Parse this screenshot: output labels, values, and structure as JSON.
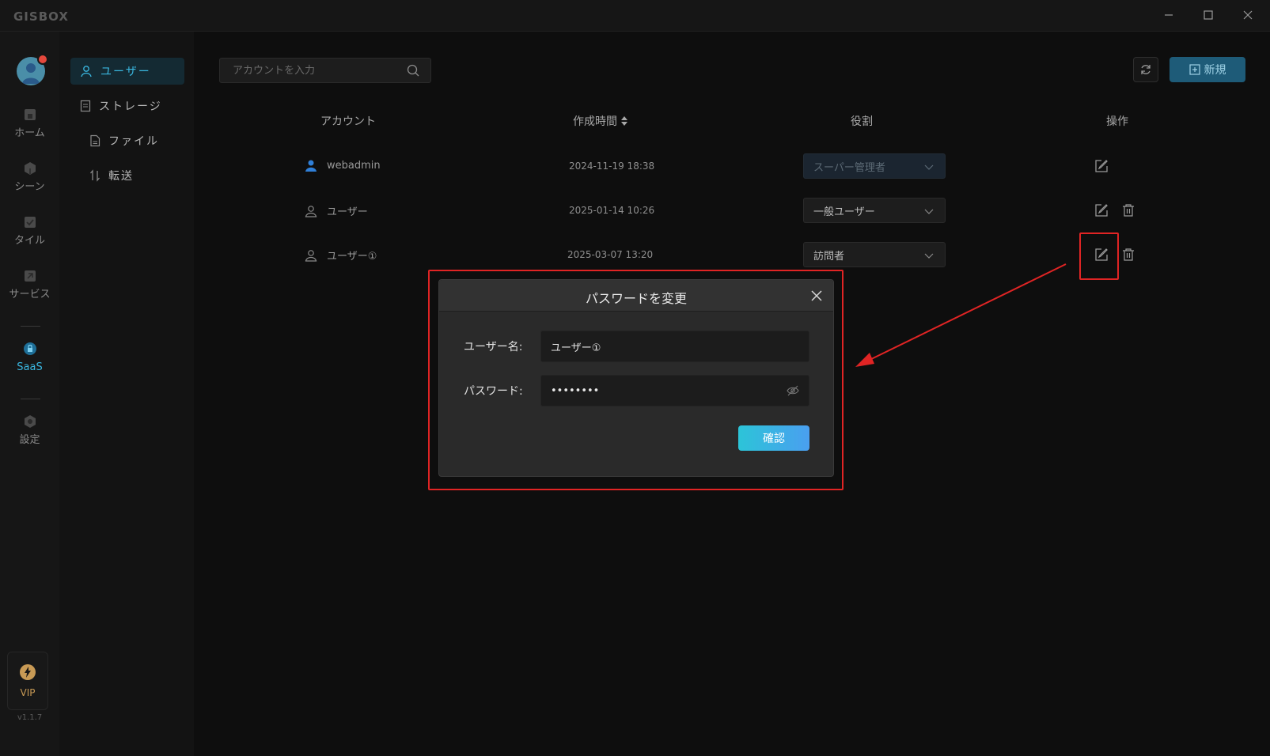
{
  "app": {
    "logo": "GISBOX",
    "version": "v1.1.7"
  },
  "rail": {
    "items": [
      {
        "label": "ホーム",
        "icon": "home-icon"
      },
      {
        "label": "シーン",
        "icon": "cube-icon"
      },
      {
        "label": "タイル",
        "icon": "tile-icon"
      },
      {
        "label": "サービス",
        "icon": "service-icon"
      },
      {
        "label": "SaaS",
        "icon": "lock-icon",
        "active": true
      },
      {
        "label": "設定",
        "icon": "gear-icon"
      }
    ],
    "vip": "VIP"
  },
  "subnav": {
    "items": [
      {
        "label": "ユーザー",
        "icon": "user-icon",
        "active": true
      },
      {
        "label": "ストレージ",
        "icon": "storage-icon"
      },
      {
        "label": "ファイル",
        "icon": "file-icon"
      },
      {
        "label": "転送",
        "icon": "transfer-icon"
      }
    ]
  },
  "toolbar": {
    "search_placeholder": "アカウントを入力",
    "new_label": "新規"
  },
  "table": {
    "headers": {
      "account": "アカウント",
      "created": "作成時間",
      "role": "役割",
      "ops": "操作"
    },
    "rows": [
      {
        "account": "webadmin",
        "created": "2024-11-19 18:38",
        "role": "スーパー管理者",
        "role_disabled": true,
        "deletable": false
      },
      {
        "account": "ユーザー",
        "created": "2025-01-14 10:26",
        "role": "一般ユーザー",
        "role_disabled": false,
        "deletable": true
      },
      {
        "account": "ユーザー①",
        "created": "2025-03-07 13:20",
        "role": "訪問者",
        "role_disabled": false,
        "deletable": true
      }
    ]
  },
  "dialog": {
    "title": "パスワードを変更",
    "username_label": "ユーザー名:",
    "username_value": "ユーザー①",
    "password_label": "パスワード:",
    "password_value": "••••••••",
    "confirm_label": "確認"
  },
  "colors": {
    "accent": "#3ab7e0",
    "annotation": "#e02424",
    "confirm_start": "#2cc4d8",
    "confirm_end": "#4a9ff0"
  }
}
